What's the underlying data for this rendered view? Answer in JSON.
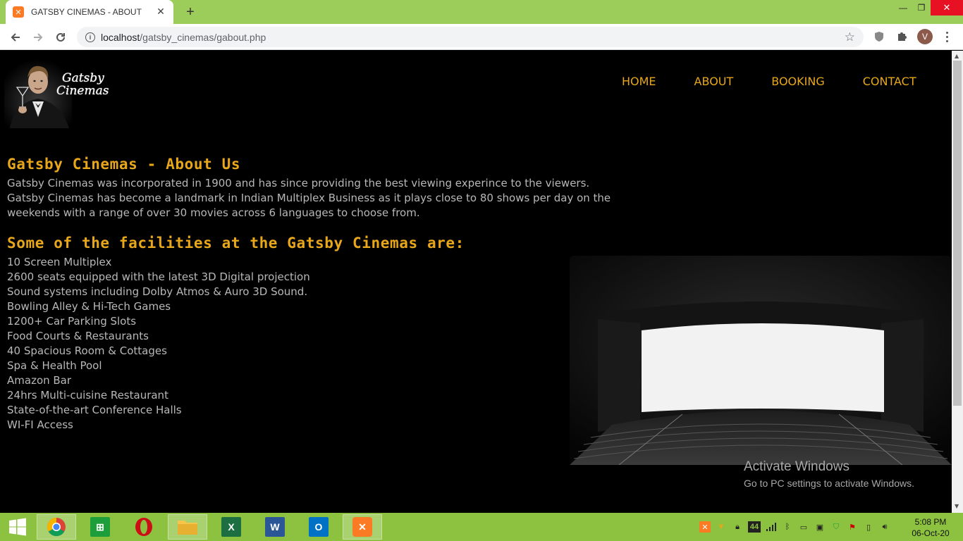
{
  "browser": {
    "tab_title": "GATSBY CINEMAS - ABOUT",
    "url_host": "localhost",
    "url_path": "/gatsby_cinemas/gabout.php",
    "profile_initial": "V"
  },
  "site": {
    "logo_line1": "Gatsby",
    "logo_line2": "Cinemas",
    "nav": [
      "HOME",
      "ABOUT",
      "BOOKING",
      "CONTACT"
    ]
  },
  "content": {
    "heading": "Gatsby Cinemas - About Us",
    "intro": "Gatsby Cinemas was incorporated in 1900 and has since providing the best viewing experince to the viewers. Gatsby Cinemas has become a landmark in Indian Multiplex Business as it plays close to 80 shows per day on the weekends with a range of over 30 movies across 6 languages to choose from.",
    "facilities_heading": "Some of the facilities at the Gatsby Cinemas are:",
    "facilities": [
      "10 Screen Multiplex",
      "2600 seats equipped with the latest 3D Digital projection",
      "Sound systems including Dolby Atmos & Auro 3D Sound.",
      "Bowling Alley & Hi-Tech Games",
      "1200+ Car Parking Slots",
      "Food Courts & Restaurants",
      "40 Spacious Room & Cottages",
      "Spa & Health Pool",
      "Amazon Bar",
      "24hrs Multi-cuisine Restaurant",
      "State-of-the-art Conference Halls",
      "WI-FI Access"
    ]
  },
  "watermark": {
    "line1": "Activate Windows",
    "line2": "Go to PC settings to activate Windows."
  },
  "taskbar": {
    "battery_badge": "44",
    "time": "5:08 PM",
    "date": "06-Oct-20"
  },
  "colors": {
    "accent": "#e8a71a",
    "text": "#b8b8b8",
    "chrome_frame": "#9ccc5a",
    "taskbar": "#8cc240"
  }
}
